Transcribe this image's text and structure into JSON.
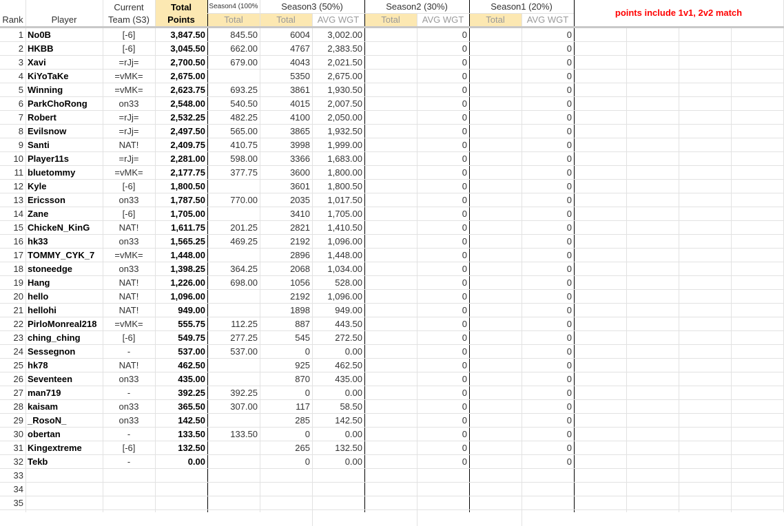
{
  "headers": {
    "rank": "Rank",
    "player": "Player",
    "team_line1": "Current",
    "team_line2": "Team (S3)",
    "total_line1": "Total",
    "total_line2": "Points",
    "season4": "Season4 (100%",
    "season3": "Season3 (50%)",
    "season2": "Season2 (30%)",
    "season1": "Season1 (20%)",
    "sub_total": "Total",
    "sub_avg": "AVG WGT",
    "note": "points include 1v1, 2v2 match"
  },
  "colors": {
    "note": "#ff0000",
    "subheader_fill": "#fce8b2",
    "grid": "#e2e2e2"
  },
  "rows": [
    {
      "rank": "1",
      "player": "No0B",
      "team": "[-6]",
      "total": "3,847.50",
      "s4": "845.50",
      "s3_total": "6004",
      "s3_avg": "3,002.00",
      "s2_avg": "0",
      "s1_avg": "0"
    },
    {
      "rank": "2",
      "player": "HKBB",
      "team": "[-6]",
      "total": "3,045.50",
      "s4": "662.00",
      "s3_total": "4767",
      "s3_avg": "2,383.50",
      "s2_avg": "0",
      "s1_avg": "0"
    },
    {
      "rank": "3",
      "player": "Xavi",
      "team": "=rJj=",
      "total": "2,700.50",
      "s4": "679.00",
      "s3_total": "4043",
      "s3_avg": "2,021.50",
      "s2_avg": "0",
      "s1_avg": "0"
    },
    {
      "rank": "4",
      "player": "KiYoTaKe",
      "team": "=vMK=",
      "total": "2,675.00",
      "s4": "",
      "s3_total": "5350",
      "s3_avg": "2,675.00",
      "s2_avg": "0",
      "s1_avg": "0"
    },
    {
      "rank": "5",
      "player": "Winning",
      "team": "=vMK=",
      "total": "2,623.75",
      "s4": "693.25",
      "s3_total": "3861",
      "s3_avg": "1,930.50",
      "s2_avg": "0",
      "s1_avg": "0"
    },
    {
      "rank": "6",
      "player": "ParkChoRong",
      "team": "on33",
      "total": "2,548.00",
      "s4": "540.50",
      "s3_total": "4015",
      "s3_avg": "2,007.50",
      "s2_avg": "0",
      "s1_avg": "0"
    },
    {
      "rank": "7",
      "player": "Robert",
      "team": "=rJj=",
      "total": "2,532.25",
      "s4": "482.25",
      "s3_total": "4100",
      "s3_avg": "2,050.00",
      "s2_avg": "0",
      "s1_avg": "0"
    },
    {
      "rank": "8",
      "player": "Evilsnow",
      "team": "=rJj=",
      "total": "2,497.50",
      "s4": "565.00",
      "s3_total": "3865",
      "s3_avg": "1,932.50",
      "s2_avg": "0",
      "s1_avg": "0"
    },
    {
      "rank": "9",
      "player": "Santi",
      "team": "NAT!",
      "total": "2,409.75",
      "s4": "410.75",
      "s3_total": "3998",
      "s3_avg": "1,999.00",
      "s2_avg": "0",
      "s1_avg": "0"
    },
    {
      "rank": "10",
      "player": "Player11s",
      "team": "=rJj=",
      "total": "2,281.00",
      "s4": "598.00",
      "s3_total": "3366",
      "s3_avg": "1,683.00",
      "s2_avg": "0",
      "s1_avg": "0"
    },
    {
      "rank": "11",
      "player": "bluetommy",
      "team": "=vMK=",
      "total": "2,177.75",
      "s4": "377.75",
      "s3_total": "3600",
      "s3_avg": "1,800.00",
      "s2_avg": "0",
      "s1_avg": "0"
    },
    {
      "rank": "12",
      "player": "Kyle",
      "team": "[-6]",
      "total": "1,800.50",
      "s4": "",
      "s3_total": "3601",
      "s3_avg": "1,800.50",
      "s2_avg": "0",
      "s1_avg": "0"
    },
    {
      "rank": "13",
      "player": "Ericsson",
      "team": "on33",
      "total": "1,787.50",
      "s4": "770.00",
      "s3_total": "2035",
      "s3_avg": "1,017.50",
      "s2_avg": "0",
      "s1_avg": "0"
    },
    {
      "rank": "14",
      "player": "Zane",
      "team": "[-6]",
      "total": "1,705.00",
      "s4": "",
      "s3_total": "3410",
      "s3_avg": "1,705.00",
      "s2_avg": "0",
      "s1_avg": "0"
    },
    {
      "rank": "15",
      "player": "ChickeN_KinG",
      "team": "NAT!",
      "total": "1,611.75",
      "s4": "201.25",
      "s3_total": "2821",
      "s3_avg": "1,410.50",
      "s2_avg": "0",
      "s1_avg": "0"
    },
    {
      "rank": "16",
      "player": "hk33",
      "team": "on33",
      "total": "1,565.25",
      "s4": "469.25",
      "s3_total": "2192",
      "s3_avg": "1,096.00",
      "s2_avg": "0",
      "s1_avg": "0"
    },
    {
      "rank": "17",
      "player": "TOMMY_CYK_7",
      "team": "=vMK=",
      "total": "1,448.00",
      "s4": "",
      "s3_total": "2896",
      "s3_avg": "1,448.00",
      "s2_avg": "0",
      "s1_avg": "0"
    },
    {
      "rank": "18",
      "player": "stoneedge",
      "team": "on33",
      "total": "1,398.25",
      "s4": "364.25",
      "s3_total": "2068",
      "s3_avg": "1,034.00",
      "s2_avg": "0",
      "s1_avg": "0"
    },
    {
      "rank": "19",
      "player": "Hang",
      "team": "NAT!",
      "total": "1,226.00",
      "s4": "698.00",
      "s3_total": "1056",
      "s3_avg": "528.00",
      "s2_avg": "0",
      "s1_avg": "0"
    },
    {
      "rank": "20",
      "player": "hello",
      "team": "NAT!",
      "total": "1,096.00",
      "s4": "",
      "s3_total": "2192",
      "s3_avg": "1,096.00",
      "s2_avg": "0",
      "s1_avg": "0"
    },
    {
      "rank": "21",
      "player": "hellohi",
      "team": "NAT!",
      "total": "949.00",
      "s4": "",
      "s3_total": "1898",
      "s3_avg": "949.00",
      "s2_avg": "0",
      "s1_avg": "0"
    },
    {
      "rank": "22",
      "player": "PirloMonreal218",
      "team": "=vMK=",
      "total": "555.75",
      "s4": "112.25",
      "s3_total": "887",
      "s3_avg": "443.50",
      "s2_avg": "0",
      "s1_avg": "0"
    },
    {
      "rank": "23",
      "player": "ching_ching",
      "team": "[-6]",
      "total": "549.75",
      "s4": "277.25",
      "s3_total": "545",
      "s3_avg": "272.50",
      "s2_avg": "0",
      "s1_avg": "0"
    },
    {
      "rank": "24",
      "player": "Sessegnon",
      "team": "-",
      "total": "537.00",
      "s4": "537.00",
      "s3_total": "0",
      "s3_avg": "0.00",
      "s2_avg": "0",
      "s1_avg": "0"
    },
    {
      "rank": "25",
      "player": "hk78",
      "team": "NAT!",
      "total": "462.50",
      "s4": "",
      "s3_total": "925",
      "s3_avg": "462.50",
      "s2_avg": "0",
      "s1_avg": "0"
    },
    {
      "rank": "26",
      "player": "Seventeen",
      "team": "on33",
      "total": "435.00",
      "s4": "",
      "s3_total": "870",
      "s3_avg": "435.00",
      "s2_avg": "0",
      "s1_avg": "0"
    },
    {
      "rank": "27",
      "player": "man719",
      "team": "-",
      "total": "392.25",
      "s4": "392.25",
      "s3_total": "0",
      "s3_avg": "0.00",
      "s2_avg": "0",
      "s1_avg": "0"
    },
    {
      "rank": "28",
      "player": "kaisam",
      "team": "on33",
      "total": "365.50",
      "s4": "307.00",
      "s3_total": "117",
      "s3_avg": "58.50",
      "s2_avg": "0",
      "s1_avg": "0"
    },
    {
      "rank": "29",
      "player": "_RosoN_",
      "team": "on33",
      "total": "142.50",
      "s4": "",
      "s3_total": "285",
      "s3_avg": "142.50",
      "s2_avg": "0",
      "s1_avg": "0"
    },
    {
      "rank": "30",
      "player": "obertan",
      "team": "-",
      "total": "133.50",
      "s4": "133.50",
      "s3_total": "0",
      "s3_avg": "0.00",
      "s2_avg": "0",
      "s1_avg": "0"
    },
    {
      "rank": "31",
      "player": "Kingextreme",
      "team": "[-6]",
      "total": "132.50",
      "s4": "",
      "s3_total": "265",
      "s3_avg": "132.50",
      "s2_avg": "0",
      "s1_avg": "0"
    },
    {
      "rank": "32",
      "player": "Tekb",
      "team": "-",
      "total": "0.00",
      "s4": "",
      "s3_total": "0",
      "s3_avg": "0.00",
      "s2_avg": "0",
      "s1_avg": "0"
    },
    {
      "rank": "33",
      "player": "",
      "team": "",
      "total": "",
      "s4": "",
      "s3_total": "",
      "s3_avg": "",
      "s2_avg": "",
      "s1_avg": ""
    },
    {
      "rank": "34",
      "player": "",
      "team": "",
      "total": "",
      "s4": "",
      "s3_total": "",
      "s3_avg": "",
      "s2_avg": "",
      "s1_avg": ""
    },
    {
      "rank": "35",
      "player": "",
      "team": "",
      "total": "",
      "s4": "",
      "s3_total": "",
      "s3_avg": "",
      "s2_avg": "",
      "s1_avg": ""
    }
  ]
}
